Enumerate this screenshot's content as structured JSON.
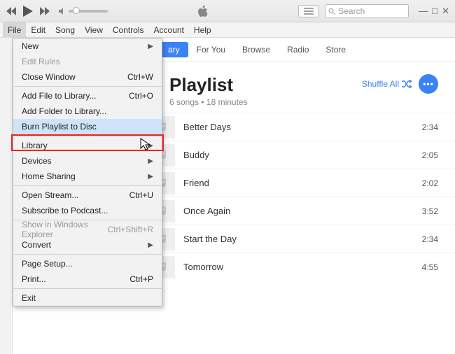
{
  "titlebar": {
    "search_placeholder": "Search",
    "win_min": "—",
    "win_max": "□",
    "win_close": "✕"
  },
  "menubar": [
    "File",
    "Edit",
    "Song",
    "View",
    "Controls",
    "Account",
    "Help"
  ],
  "tabs": [
    "Library",
    "For You",
    "Browse",
    "Radio",
    "Store"
  ],
  "playlist": {
    "title": "Playlist",
    "meta": "6 songs • 18 minutes",
    "shuffle": "Shuffle All",
    "more": "•••"
  },
  "songs": [
    {
      "title": "Better Days",
      "len": "2:34"
    },
    {
      "title": "Buddy",
      "len": "2:05"
    },
    {
      "title": "Friend",
      "len": "2:02"
    },
    {
      "title": "Once Again",
      "len": "3:52"
    },
    {
      "title": "Start the Day",
      "len": "2:34"
    },
    {
      "title": "Tomorrow",
      "len": "4:55"
    }
  ],
  "dropdown": [
    {
      "label": "New",
      "arrow": true
    },
    {
      "label": "Edit Rules",
      "disabled": true
    },
    {
      "label": "Close Window",
      "shortcut": "Ctrl+W"
    },
    {
      "sep": true
    },
    {
      "label": "Add File to Library...",
      "shortcut": "Ctrl+O"
    },
    {
      "label": "Add Folder to Library..."
    },
    {
      "label": "Burn Playlist to Disc",
      "hl": true
    },
    {
      "sep": true
    },
    {
      "label": "Library",
      "arrow": true
    },
    {
      "label": "Devices",
      "arrow": true
    },
    {
      "label": "Home Sharing",
      "arrow": true
    },
    {
      "sep": true
    },
    {
      "label": "Open Stream...",
      "shortcut": "Ctrl+U"
    },
    {
      "label": "Subscribe to Podcast..."
    },
    {
      "sep": true
    },
    {
      "label": "Show in Windows Explorer",
      "shortcut": "Ctrl+Shift+R",
      "disabled": true
    },
    {
      "label": "Convert",
      "arrow": true
    },
    {
      "sep": true
    },
    {
      "label": "Page Setup..."
    },
    {
      "label": "Print...",
      "shortcut": "Ctrl+P"
    },
    {
      "sep": true
    },
    {
      "label": "Exit"
    }
  ]
}
